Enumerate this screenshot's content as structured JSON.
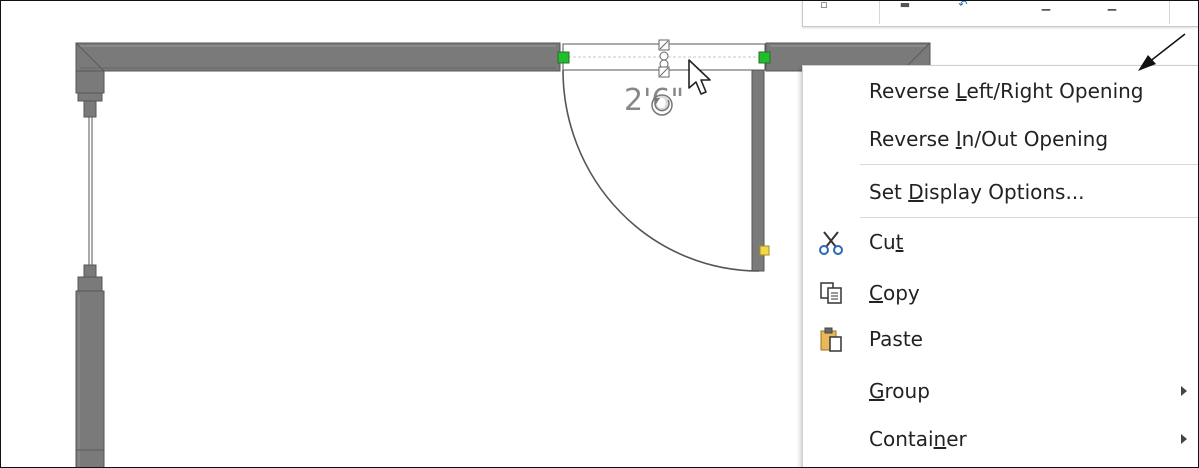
{
  "drawing": {
    "dimension_label": "2'6\""
  },
  "toolbar": {
    "icons": [
      "shape-icon",
      "line-icon",
      "connector-icon",
      "container-icon",
      "fill-icon"
    ]
  },
  "context_menu": {
    "items": [
      {
        "pre": "Reverse ",
        "key": "L",
        "post": "eft/Right Opening",
        "submenu": false
      },
      {
        "pre": "Reverse ",
        "key": "I",
        "post": "n/Out Opening",
        "submenu": false
      },
      {
        "pre": "Set ",
        "key": "D",
        "post": "isplay Options...",
        "submenu": false
      },
      {
        "pre": "Cu",
        "key": "t",
        "post": "",
        "icon": "scissors-icon",
        "submenu": false
      },
      {
        "pre": "",
        "key": "C",
        "post": "opy",
        "icon": "copy-icon",
        "submenu": false
      },
      {
        "pre": "Paste",
        "key": "",
        "post": "",
        "icon": "paste-icon",
        "submenu": false
      },
      {
        "pre": "",
        "key": "G",
        "post": "roup",
        "submenu": true
      },
      {
        "pre": "Contai",
        "key": "n",
        "post": "er",
        "submenu": true
      }
    ]
  },
  "colors": {
    "wall": "#7a7a7a",
    "handle_green": "#1fbf2a",
    "handle_yellow": "#f2d64b",
    "menu_text": "#222222"
  }
}
